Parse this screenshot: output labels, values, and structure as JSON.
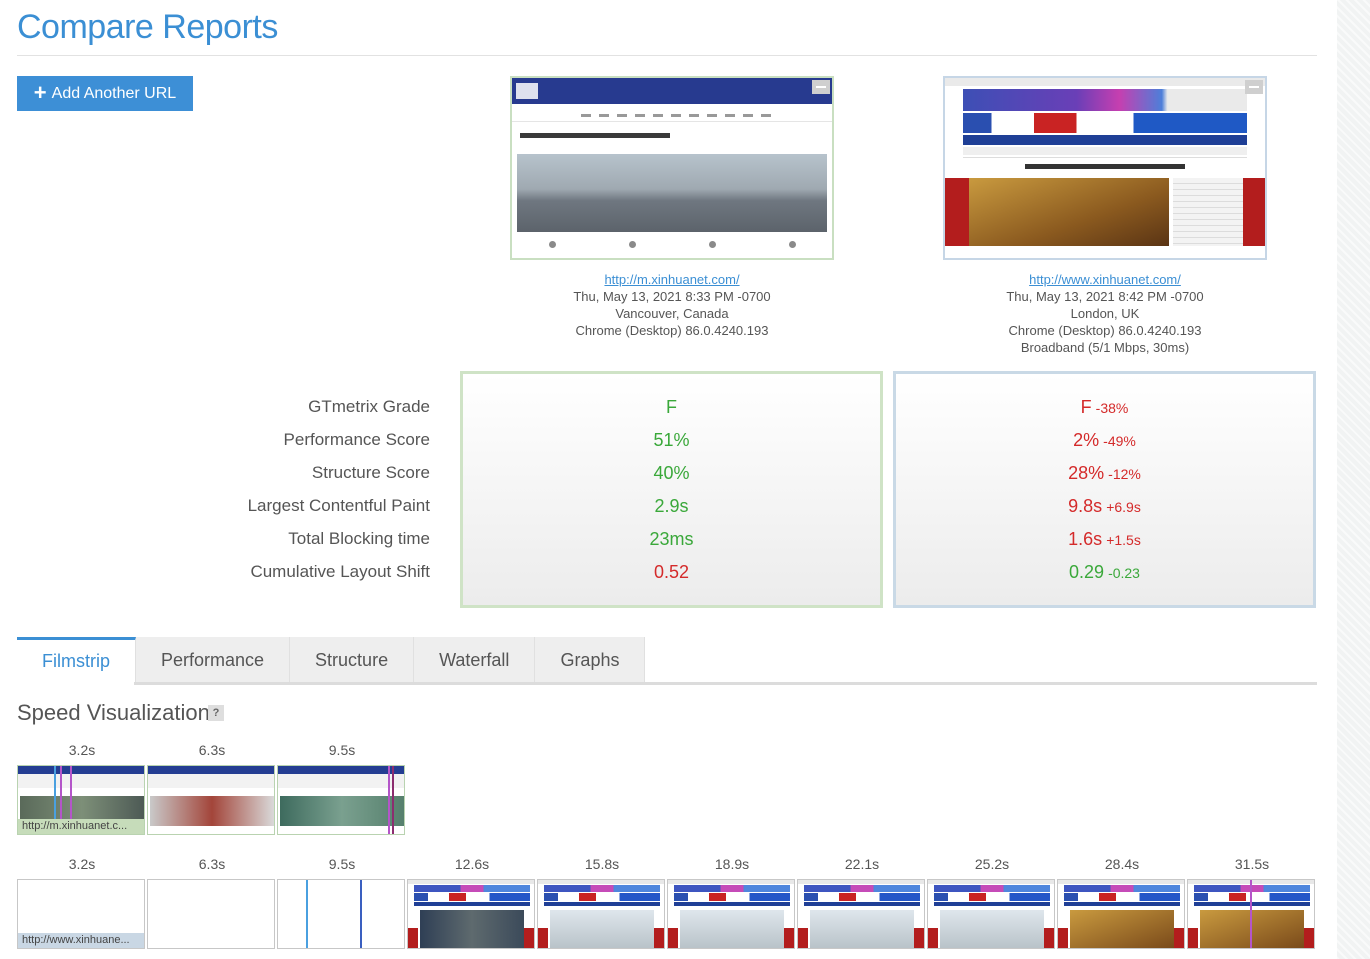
{
  "page": {
    "title": "Compare Reports"
  },
  "actions": {
    "add_url_label": "Add Another URL",
    "add_url_icon": "plus-icon"
  },
  "reports": [
    {
      "url": "http://m.xinhuanet.com/",
      "date": "Thu, May 13, 2021 8:33 PM -0700",
      "location": "Vancouver, Canada",
      "browser": "Chrome (Desktop) 86.0.4240.193",
      "connection": ""
    },
    {
      "url": "http://www.xinhuanet.com/",
      "date": "Thu, May 13, 2021 8:42 PM -0700",
      "location": "London, UK",
      "browser": "Chrome (Desktop) 86.0.4240.193",
      "connection": "Broadband (5/1 Mbps, 30ms)"
    }
  ],
  "metrics": {
    "labels": [
      "GTmetrix Grade",
      "Performance Score",
      "Structure Score",
      "Largest Contentful Paint",
      "Total Blocking time",
      "Cumulative Layout Shift"
    ],
    "report_a": [
      {
        "value": "F",
        "status": "good"
      },
      {
        "value": "51%",
        "status": "good"
      },
      {
        "value": "40%",
        "status": "good"
      },
      {
        "value": "2.9s",
        "status": "good"
      },
      {
        "value": "23ms",
        "status": "good"
      },
      {
        "value": "0.52",
        "status": "bad"
      }
    ],
    "report_b": [
      {
        "value": "F",
        "delta": "-38%",
        "status": "bad"
      },
      {
        "value": "2%",
        "delta": "-49%",
        "status": "bad"
      },
      {
        "value": "28%",
        "delta": "-12%",
        "status": "bad"
      },
      {
        "value": "9.8s",
        "delta": "+6.9s",
        "status": "bad"
      },
      {
        "value": "1.6s",
        "delta": "+1.5s",
        "status": "bad"
      },
      {
        "value": "0.29",
        "delta": "-0.23",
        "status": "good"
      }
    ]
  },
  "tabs": [
    {
      "label": "Filmstrip",
      "active": true
    },
    {
      "label": "Performance",
      "active": false
    },
    {
      "label": "Structure",
      "active": false
    },
    {
      "label": "Waterfall",
      "active": false
    },
    {
      "label": "Graphs",
      "active": false
    }
  ],
  "speed_visualization": {
    "title": "Speed Visualization",
    "help_label": "?",
    "strip_a": {
      "caption": "http://m.xinhuanet.c...",
      "times": [
        "3.2s",
        "6.3s",
        "9.5s"
      ]
    },
    "strip_b": {
      "caption": "http://www.xinhuane...",
      "times": [
        "3.2s",
        "6.3s",
        "9.5s",
        "12.6s",
        "15.8s",
        "18.9s",
        "22.1s",
        "25.2s",
        "28.4s",
        "31.5s"
      ]
    }
  },
  "colors": {
    "accent": "#3b8fd4",
    "good": "#3aa83a",
    "bad": "#d42a2a",
    "report_a_border": "#cfe3c6",
    "report_b_border": "#c9d9e6"
  }
}
